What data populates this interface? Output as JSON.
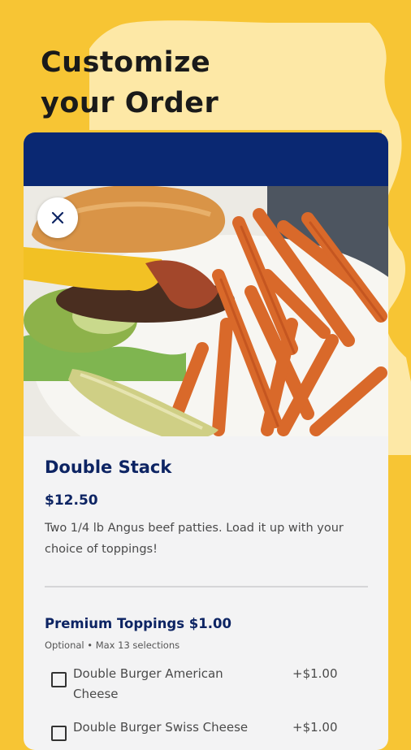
{
  "headline": {
    "line1": "Customize",
    "line2": "your Order"
  },
  "item": {
    "name": "Double Stack",
    "price": "$12.50",
    "description": "Two 1/4 lb Angus beef patties.  Load it up with your choice of toppings!"
  },
  "modifier_group": {
    "title": "Premium Toppings $1.00",
    "subtitle": "Optional • Max 13 selections",
    "options": [
      {
        "label": "Double Burger American Cheese",
        "price": "+$1.00",
        "checked": false
      },
      {
        "label": "Double Burger Swiss Cheese",
        "price": "+$1.00",
        "checked": false
      }
    ]
  },
  "icons": {
    "close": "close-icon",
    "checkbox": "checkbox-icon"
  },
  "colors": {
    "background": "#f7c534",
    "background_blob": "#fde8a6",
    "card_header": "#0a2872",
    "title_text": "#0d2463",
    "card_body": "#f3f3f4"
  }
}
